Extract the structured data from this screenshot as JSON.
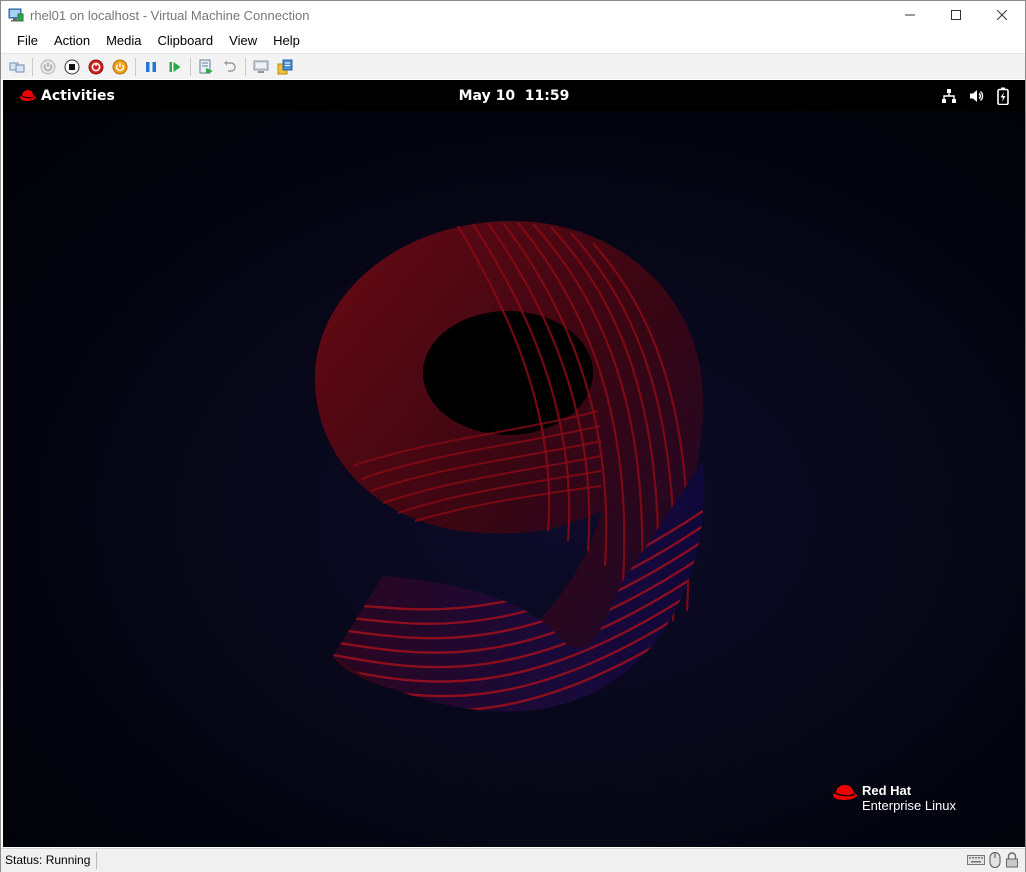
{
  "window": {
    "title": "rhel01 on localhost - Virtual Machine Connection"
  },
  "menu": [
    "File",
    "Action",
    "Media",
    "Clipboard",
    "View",
    "Help"
  ],
  "toolbar": {
    "buttons": [
      "ctrl-alt-del",
      "start",
      "turn-off",
      "shut-down",
      "save",
      "pause",
      "resume",
      "checkpoint",
      "revert",
      "enhanced-session",
      "share"
    ]
  },
  "gnome": {
    "activities_label": "Activities",
    "clock": "May 10  11:59",
    "tray_icons": [
      "network-icon",
      "volume-icon",
      "battery-icon"
    ]
  },
  "desktop": {
    "wallpaper_glyph": "9",
    "brand_line1": "Red Hat",
    "brand_line2": "Enterprise Linux",
    "brand_color": "#ee0000"
  },
  "status": {
    "text": "Status: Running",
    "icons": [
      "keyboard-icon",
      "mouse-icon",
      "lock-icon"
    ]
  }
}
